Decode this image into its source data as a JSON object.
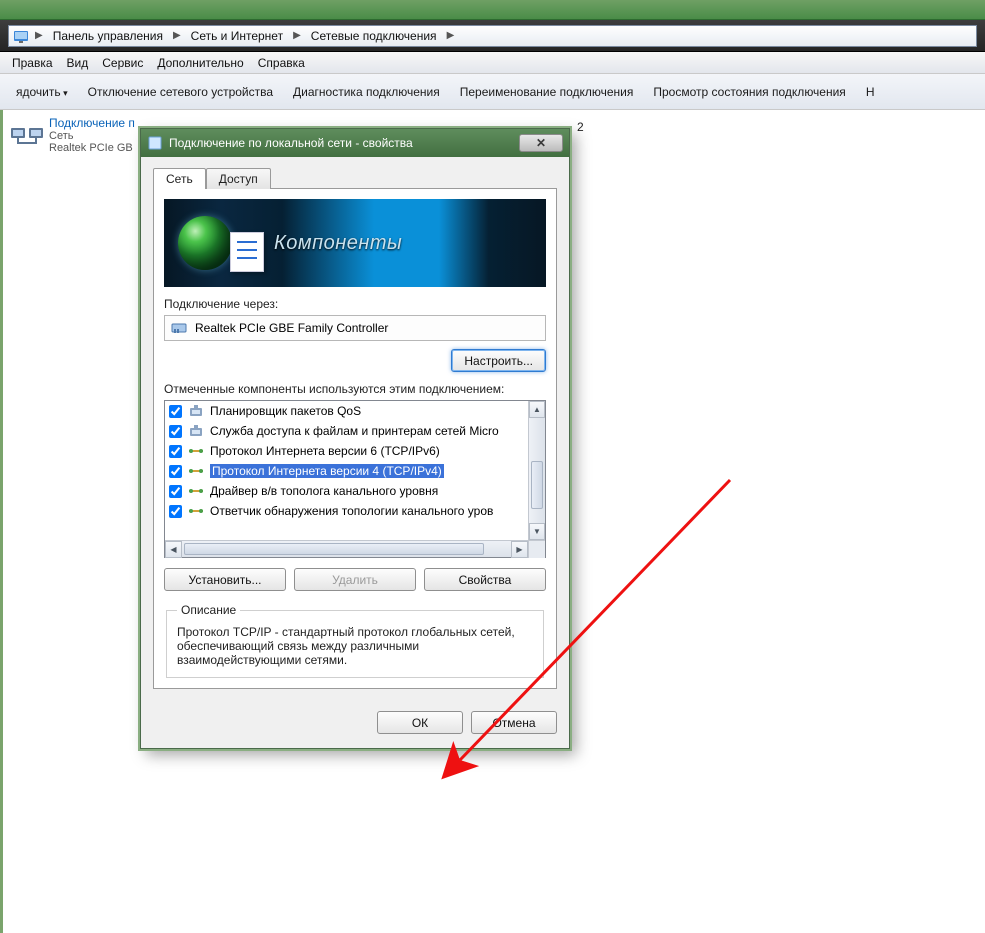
{
  "breadcrumbs": {
    "items": [
      "Панель управления",
      "Сеть и Интернет",
      "Сетевые подключения"
    ]
  },
  "menu": {
    "items": [
      "Правка",
      "Вид",
      "Сервис",
      "Дополнительно",
      "Справка"
    ]
  },
  "toolbar": {
    "items": [
      {
        "label": "ядочить",
        "dropdown": true
      },
      {
        "label": "Отключение сетевого устройства",
        "dropdown": false
      },
      {
        "label": "Диагностика подключения",
        "dropdown": false
      },
      {
        "label": "Переименование подключения",
        "dropdown": false
      },
      {
        "label": "Просмотр состояния подключения",
        "dropdown": false
      },
      {
        "label": "Н",
        "dropdown": false
      }
    ]
  },
  "connection_item": {
    "title": "Подключение п",
    "line2": "Сеть",
    "line3": "Realtek PCIe GB"
  },
  "stray_text_2": "2",
  "dialog": {
    "title": "Подключение по локальной сети - свойства",
    "tabs": {
      "net": "Сеть",
      "access": "Доступ"
    },
    "banner_caption": "Компоненты",
    "connect_via_label": "Подключение через:",
    "adapter_name": "Realtek PCIe GBE Family Controller",
    "configure_btn": "Настроить...",
    "components_label": "Отмеченные компоненты используются этим подключением:",
    "components": [
      {
        "checked": true,
        "label": "Планировщик пакетов QoS",
        "selected": false,
        "icon": "service"
      },
      {
        "checked": true,
        "label": "Служба доступа к файлам и принтерам сетей Micro",
        "selected": false,
        "icon": "service"
      },
      {
        "checked": true,
        "label": "Протокол Интернета версии 6 (TCP/IPv6)",
        "selected": false,
        "icon": "protocol"
      },
      {
        "checked": true,
        "label": "Протокол Интернета версии 4 (TCP/IPv4)",
        "selected": true,
        "icon": "protocol"
      },
      {
        "checked": true,
        "label": "Драйвер в/в тополога канального уровня",
        "selected": false,
        "icon": "protocol"
      },
      {
        "checked": true,
        "label": "Ответчик обнаружения топологии канального уров",
        "selected": false,
        "icon": "protocol"
      }
    ],
    "install_btn": "Установить...",
    "remove_btn": "Удалить",
    "properties_btn": "Свойства",
    "description_legend": "Описание",
    "description_text": "Протокол TCP/IP - стандартный протокол глобальных сетей, обеспечивающий связь между различными взаимодействующими сетями.",
    "ok_btn": "ОК",
    "cancel_btn": "Отмена"
  }
}
